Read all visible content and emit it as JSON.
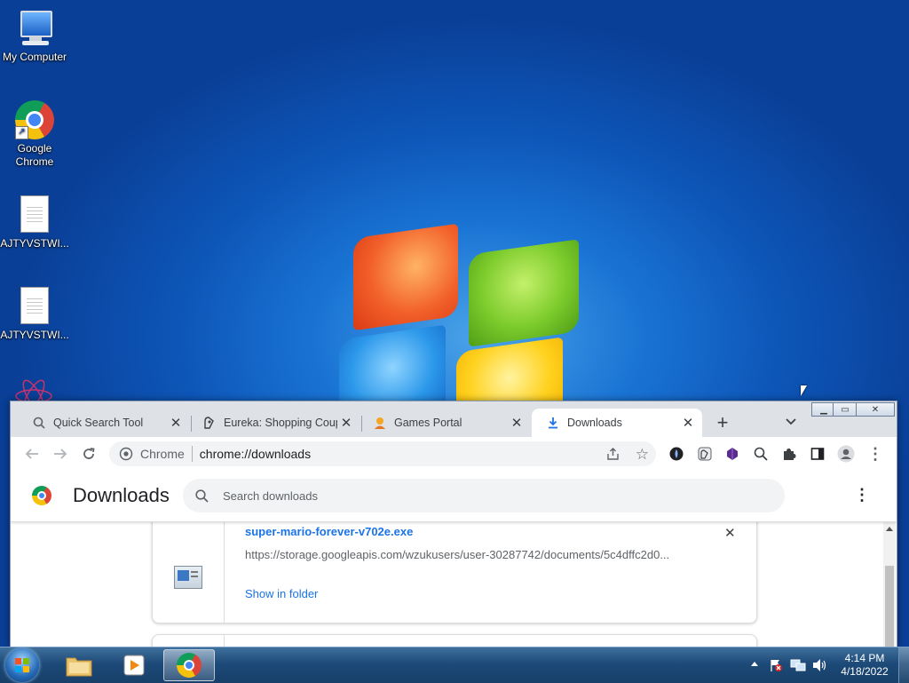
{
  "desktop": {
    "icons": [
      {
        "label": "My Computer"
      },
      {
        "label": "Google Chrome"
      },
      {
        "label": "AJTYVSTWI..."
      },
      {
        "label": "AJTYVSTWI..."
      }
    ]
  },
  "browser": {
    "tabs": [
      {
        "title": "Quick Search Tool",
        "icon": "search-icon"
      },
      {
        "title": "Eureka: Shopping Coupons",
        "icon": "eureka-icon"
      },
      {
        "title": "Games Portal",
        "icon": "games-icon"
      },
      {
        "title": "Downloads",
        "icon": "download-icon",
        "active": true
      }
    ],
    "new_tab_label": "+",
    "omnibox": {
      "site_label": "Chrome",
      "url": "chrome://downloads"
    },
    "page": {
      "title": "Downloads",
      "search_placeholder": "Search downloads",
      "items": [
        {
          "filename": "super-mario-forever-v702e.exe",
          "url": "https://storage.googleapis.com/wzukusers/user-30287742/documents/5c4dffc2d0...",
          "action": "Show in folder"
        }
      ]
    }
  },
  "taskbar": {
    "clock_time": "4:14 PM",
    "clock_date": "4/18/2022"
  },
  "colors": {
    "link_blue": "#1a73e8",
    "desktop_blue": "#1a74d4",
    "taskbar": "#1d4a78"
  }
}
